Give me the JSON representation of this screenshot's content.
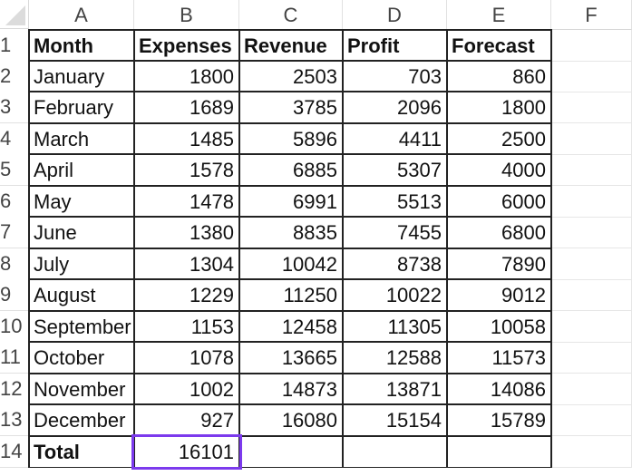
{
  "columns": [
    "A",
    "B",
    "C",
    "D",
    "E",
    "F"
  ],
  "rows": [
    "1",
    "2",
    "3",
    "4",
    "5",
    "6",
    "7",
    "8",
    "9",
    "10",
    "11",
    "12",
    "13",
    "14"
  ],
  "header": [
    "Month",
    "Expenses",
    "Revenue",
    "Profit",
    "Forecast"
  ],
  "data": [
    [
      "January",
      "1800",
      "2503",
      "703",
      "860"
    ],
    [
      "February",
      "1689",
      "3785",
      "2096",
      "1800"
    ],
    [
      "March",
      "1485",
      "5896",
      "4411",
      "2500"
    ],
    [
      "April",
      "1578",
      "6885",
      "5307",
      "4000"
    ],
    [
      "May",
      "1478",
      "6991",
      "5513",
      "6000"
    ],
    [
      "June",
      "1380",
      "8835",
      "7455",
      "6800"
    ],
    [
      "July",
      "1304",
      "10042",
      "8738",
      "7890"
    ],
    [
      "August",
      "1229",
      "11250",
      "10022",
      "9012"
    ],
    [
      "September",
      "1153",
      "12458",
      "11305",
      "10058"
    ],
    [
      "October",
      "1078",
      "13665",
      "12588",
      "11573"
    ],
    [
      "November",
      "1002",
      "14873",
      "13871",
      "14086"
    ],
    [
      "December",
      "927",
      "16080",
      "15154",
      "15789"
    ]
  ],
  "total": {
    "label": "Total",
    "expenses": "16101",
    "revenue": "",
    "profit": "",
    "forecast": ""
  },
  "selected_cell": "B14",
  "colors": {
    "selection": "#7c3aed"
  }
}
